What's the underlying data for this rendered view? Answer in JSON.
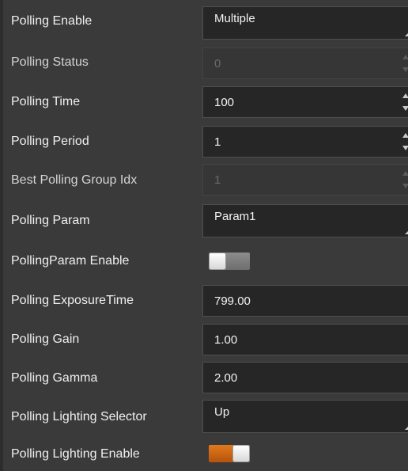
{
  "rows": [
    {
      "label": "Polling Enable",
      "value": "Multiple",
      "kind": "select",
      "state": "enabled"
    },
    {
      "label": "Polling Status",
      "value": "0",
      "kind": "spin",
      "state": "disabled"
    },
    {
      "label": "Polling Time",
      "value": "100",
      "kind": "spin",
      "state": "enabled"
    },
    {
      "label": "Polling Period",
      "value": "1",
      "kind": "spin",
      "state": "enabled"
    },
    {
      "label": "Best Polling Group Idx",
      "value": "1",
      "kind": "spin",
      "state": "disabled"
    },
    {
      "label": "Polling Param",
      "value": "Param1",
      "kind": "select",
      "state": "enabled"
    },
    {
      "label": "PollingParam Enable",
      "value": "off",
      "kind": "toggle",
      "state": "enabled"
    },
    {
      "label": "Polling ExposureTime",
      "value": "799.00",
      "kind": "text",
      "state": "enabled"
    },
    {
      "label": "Polling Gain",
      "value": "1.00",
      "kind": "text",
      "state": "enabled"
    },
    {
      "label": "Polling Gamma",
      "value": "2.00",
      "kind": "text",
      "state": "enabled"
    },
    {
      "label": "Polling Lighting Selector",
      "value": "Up",
      "kind": "select",
      "state": "enabled"
    },
    {
      "label": "Polling Lighting Enable",
      "value": "on",
      "kind": "toggle",
      "state": "enabled"
    }
  ],
  "colors": {
    "panel_bg": "#3a3a3a",
    "field_bg": "#262626",
    "toggle_on": "#d46a16",
    "label_text": "#f0f0f0"
  },
  "icons": {
    "select": "dropdown-corner-icon",
    "spin": "spinner-arrows-icon",
    "toggle": "toggle-switch"
  }
}
